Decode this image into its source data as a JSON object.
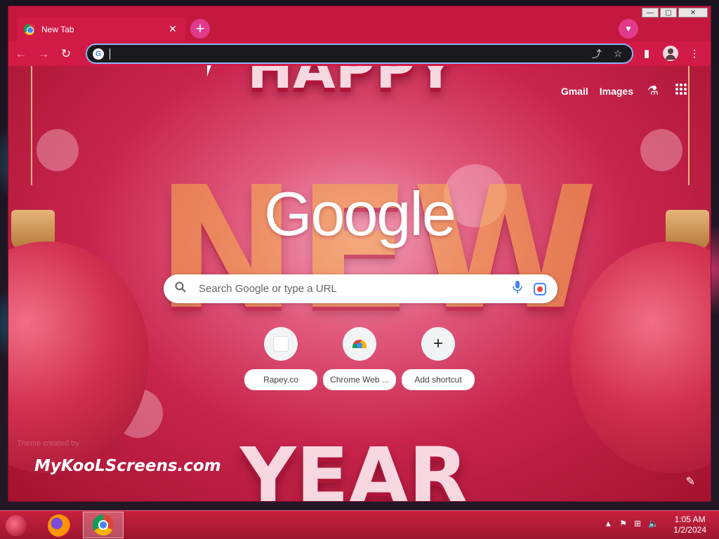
{
  "browser": {
    "tab": {
      "title": "New Tab",
      "close": "✕"
    },
    "new_tab_icon": "plus-icon",
    "tab_search_icon": "chevron-down-icon",
    "window_controls": {
      "minimize": "—",
      "maximize": "▢",
      "close": "✕"
    }
  },
  "toolbar": {
    "back": "←",
    "forward": "→",
    "reload": "↻",
    "omnibox_value": "",
    "share_icon": "⤴",
    "bookmark_icon": "☆",
    "side_panel_icon": "▮",
    "menu_icon": "⋮"
  },
  "ntp": {
    "links": {
      "gmail": "Gmail",
      "images": "Images"
    },
    "labs_icon": "⚗",
    "apps_icon": "⋮⋮⋮",
    "logo": "Google",
    "search_placeholder": "Search Google or type a URL",
    "shortcuts": [
      {
        "label": "Rapey.co"
      },
      {
        "label": "Chrome Web ..."
      },
      {
        "label": "Add shortcut"
      }
    ],
    "theme_credit": "Theme created by",
    "watermark": "MyKooLScreens.com",
    "edit_icon": "✎",
    "theme_text": {
      "top": "HAPPY",
      "middle": "NEW",
      "bottom": "YEAR"
    }
  },
  "taskbar": {
    "tray_icons": [
      "▲",
      "⚑",
      "⊞",
      "🔈"
    ],
    "clock_time": "1:05 AM",
    "clock_date": "1/2/2024"
  },
  "colors": {
    "theme_primary": "#c4183f",
    "omnibox_border": "#8ab4f8",
    "accent_pink": "#e23a8a"
  }
}
